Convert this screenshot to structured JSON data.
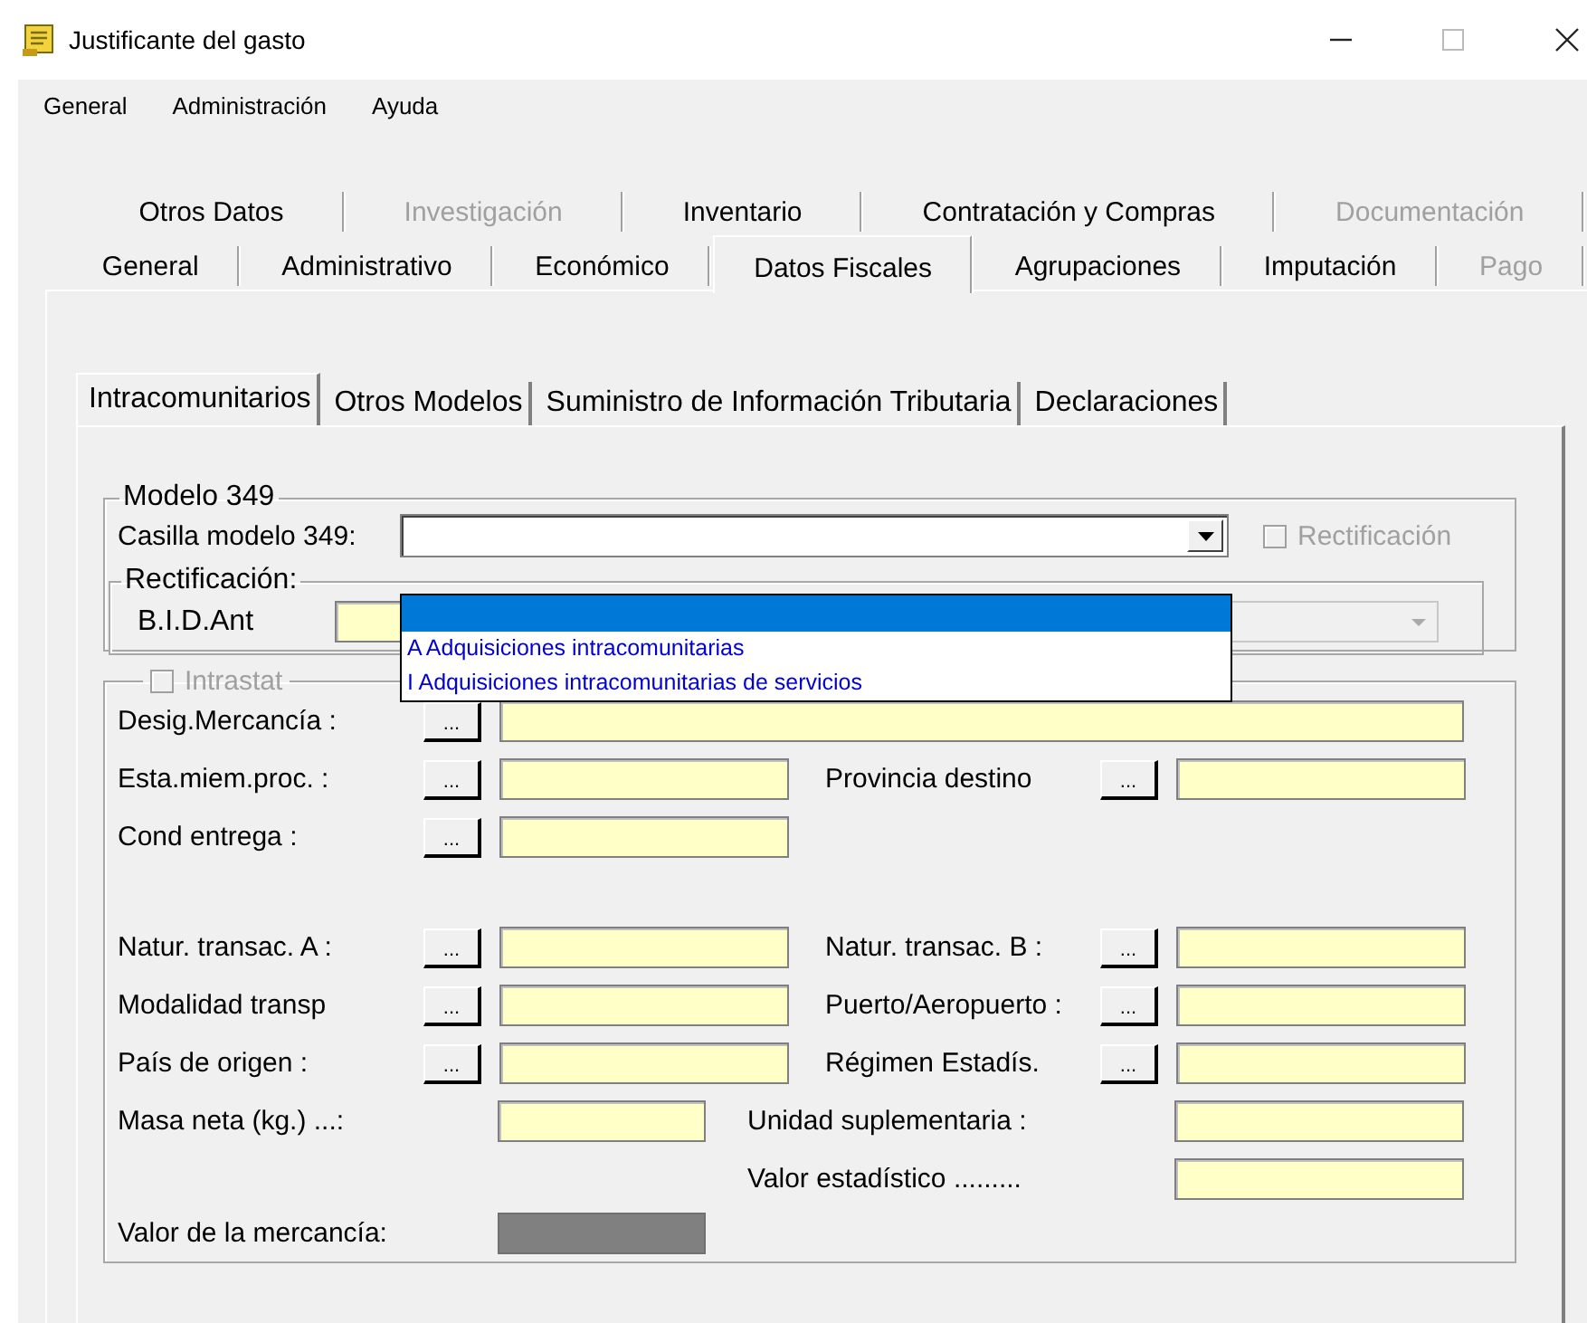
{
  "window": {
    "title": "Justificante del gasto"
  },
  "menu": [
    "General",
    "Administración",
    "Ayuda"
  ],
  "tab_rows": [
    [
      {
        "label": "Otros Datos",
        "selected": false,
        "disabled": false
      },
      {
        "label": "Investigación",
        "selected": false,
        "disabled": true
      },
      {
        "label": "Inventario",
        "selected": false,
        "disabled": false
      },
      {
        "label": "Contratación y Compras",
        "selected": false,
        "disabled": false
      },
      {
        "label": "Documentación",
        "selected": false,
        "disabled": true
      }
    ],
    [
      {
        "label": "General",
        "selected": false,
        "disabled": false
      },
      {
        "label": "Administrativo",
        "selected": false,
        "disabled": false
      },
      {
        "label": "Económico",
        "selected": false,
        "disabled": false
      },
      {
        "label": "Datos Fiscales",
        "selected": true,
        "disabled": false
      },
      {
        "label": "Agrupaciones",
        "selected": false,
        "disabled": false
      },
      {
        "label": "Imputación",
        "selected": false,
        "disabled": false
      },
      {
        "label": "Pago",
        "selected": false,
        "disabled": true
      }
    ]
  ],
  "subtabs": [
    {
      "label": "Intracomunitarios",
      "selected": true
    },
    {
      "label": "Otros Modelos",
      "selected": false
    },
    {
      "label": "Suministro de Información Tributaria",
      "selected": false
    },
    {
      "label": "Declaraciones",
      "selected": false
    }
  ],
  "modelo_349": {
    "title": "Modelo 349",
    "combo_label": "Casilla modelo 349:",
    "rectificacion_checkbox": {
      "label": "Rectificación",
      "checked": false,
      "disabled": true
    },
    "rectificacion_group": {
      "title": "Rectificación:",
      "label": "B.I.D.Ant"
    },
    "dropdown": [
      {
        "selected": true
      },
      {
        "label": "A Adquisiciones intracomunitarias",
        "selected": false
      },
      {
        "label": "I Adquisiciones intracomunitarias de servicios",
        "selected": false
      }
    ]
  },
  "intrastat": {
    "checkbox": {
      "label": "Intrastat",
      "checked": false,
      "disabled": true
    },
    "sections": [
      {
        "rows": [
          {
            "cells": [
              {
                "kind": "label",
                "text": "Desig.Mercancía :"
              },
              {
                "kind": "lookup",
                "text": "..."
              },
              {
                "kind": "field_long"
              }
            ]
          },
          {
            "cells": [
              {
                "kind": "label",
                "text": "Esta.miem.proc. :"
              },
              {
                "kind": "lookup",
                "text": "..."
              },
              {
                "kind": "field"
              },
              {
                "kind": "label",
                "text": "Provincia destino"
              },
              {
                "kind": "lookup",
                "text": "..."
              },
              {
                "kind": "field"
              }
            ]
          },
          {
            "cells": [
              {
                "kind": "label",
                "text": "Cond entrega :"
              },
              {
                "kind": "lookup",
                "text": "..."
              },
              {
                "kind": "field"
              }
            ]
          }
        ]
      },
      {
        "rows": [
          {
            "cells": [
              {
                "kind": "label",
                "text": "Natur. transac. A :"
              },
              {
                "kind": "lookup",
                "text": "..."
              },
              {
                "kind": "field"
              },
              {
                "kind": "label",
                "text": "Natur. transac. B :"
              },
              {
                "kind": "lookup",
                "text": "..."
              },
              {
                "kind": "field"
              }
            ]
          },
          {
            "cells": [
              {
                "kind": "label",
                "text": "Modalidad transp"
              },
              {
                "kind": "lookup",
                "text": "..."
              },
              {
                "kind": "field"
              },
              {
                "kind": "label",
                "text": "Puerto/Aeropuerto :"
              },
              {
                "kind": "lookup",
                "text": "..."
              },
              {
                "kind": "field"
              }
            ]
          },
          {
            "cells": [
              {
                "kind": "label",
                "text": "País de origen :"
              },
              {
                "kind": "lookup",
                "text": "..."
              },
              {
                "kind": "field"
              },
              {
                "kind": "label",
                "text": "Régimen Estadís."
              },
              {
                "kind": "lookup",
                "text": "..."
              },
              {
                "kind": "field"
              }
            ]
          },
          {
            "cells": [
              {
                "kind": "label_wide",
                "text": "Masa neta (kg.) ...:"
              },
              {
                "kind": "field_short"
              },
              {
                "kind": "label_mid",
                "text": "Unidad suplementaria :"
              },
              {
                "kind": "field"
              }
            ]
          },
          {
            "cells": [
              {
                "kind": "blank_label"
              },
              {
                "kind": "blank_field"
              },
              {
                "kind": "label_mid",
                "text": "Valor estadístico ........."
              },
              {
                "kind": "field"
              }
            ]
          }
        ]
      },
      {
        "rows": [
          {
            "cells": [
              {
                "kind": "label_wide",
                "text": "Valor de la mercancía:"
              },
              {
                "kind": "field_gray"
              }
            ]
          }
        ]
      }
    ]
  }
}
